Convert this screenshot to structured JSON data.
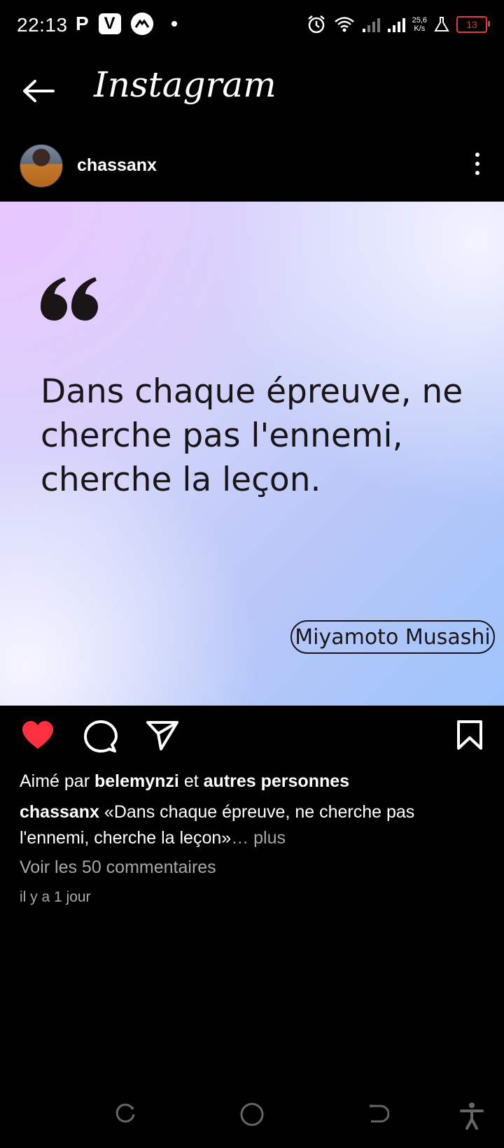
{
  "status_bar": {
    "time": "22:13",
    "left_icons": [
      "p-icon",
      "v-app-icon",
      "app-circle-icon",
      "notification-dot"
    ],
    "p_label": "P",
    "v_label": "V",
    "speed_value": "25,6",
    "speed_unit": "K/s",
    "battery": "13",
    "battery_color": "#e53935"
  },
  "header": {
    "brand": "Instagram"
  },
  "post": {
    "username": "chassanx",
    "quote": "Dans chaque épreuve, ne cherche pas l'ennemi, cherche la leçon.",
    "author": "Miyamoto Musashi",
    "liked": true,
    "like_color": "#ff3040",
    "likes": {
      "prefix": "Aimé par",
      "user": "belemynzi",
      "middle": "et",
      "rest": "autres personnes"
    },
    "caption": {
      "user": "chassanx",
      "text": "«Dans chaque épreuve, ne cherche pas l'ennemi, cherche la leçon»",
      "more": "… plus"
    },
    "comments_link": "Voir les 50 commentaires",
    "time_ago": "il y a 1 jour"
  },
  "navbar": {
    "items": [
      "recents-icon",
      "home-circle-icon",
      "back-icon",
      "accessibility-icon"
    ]
  }
}
